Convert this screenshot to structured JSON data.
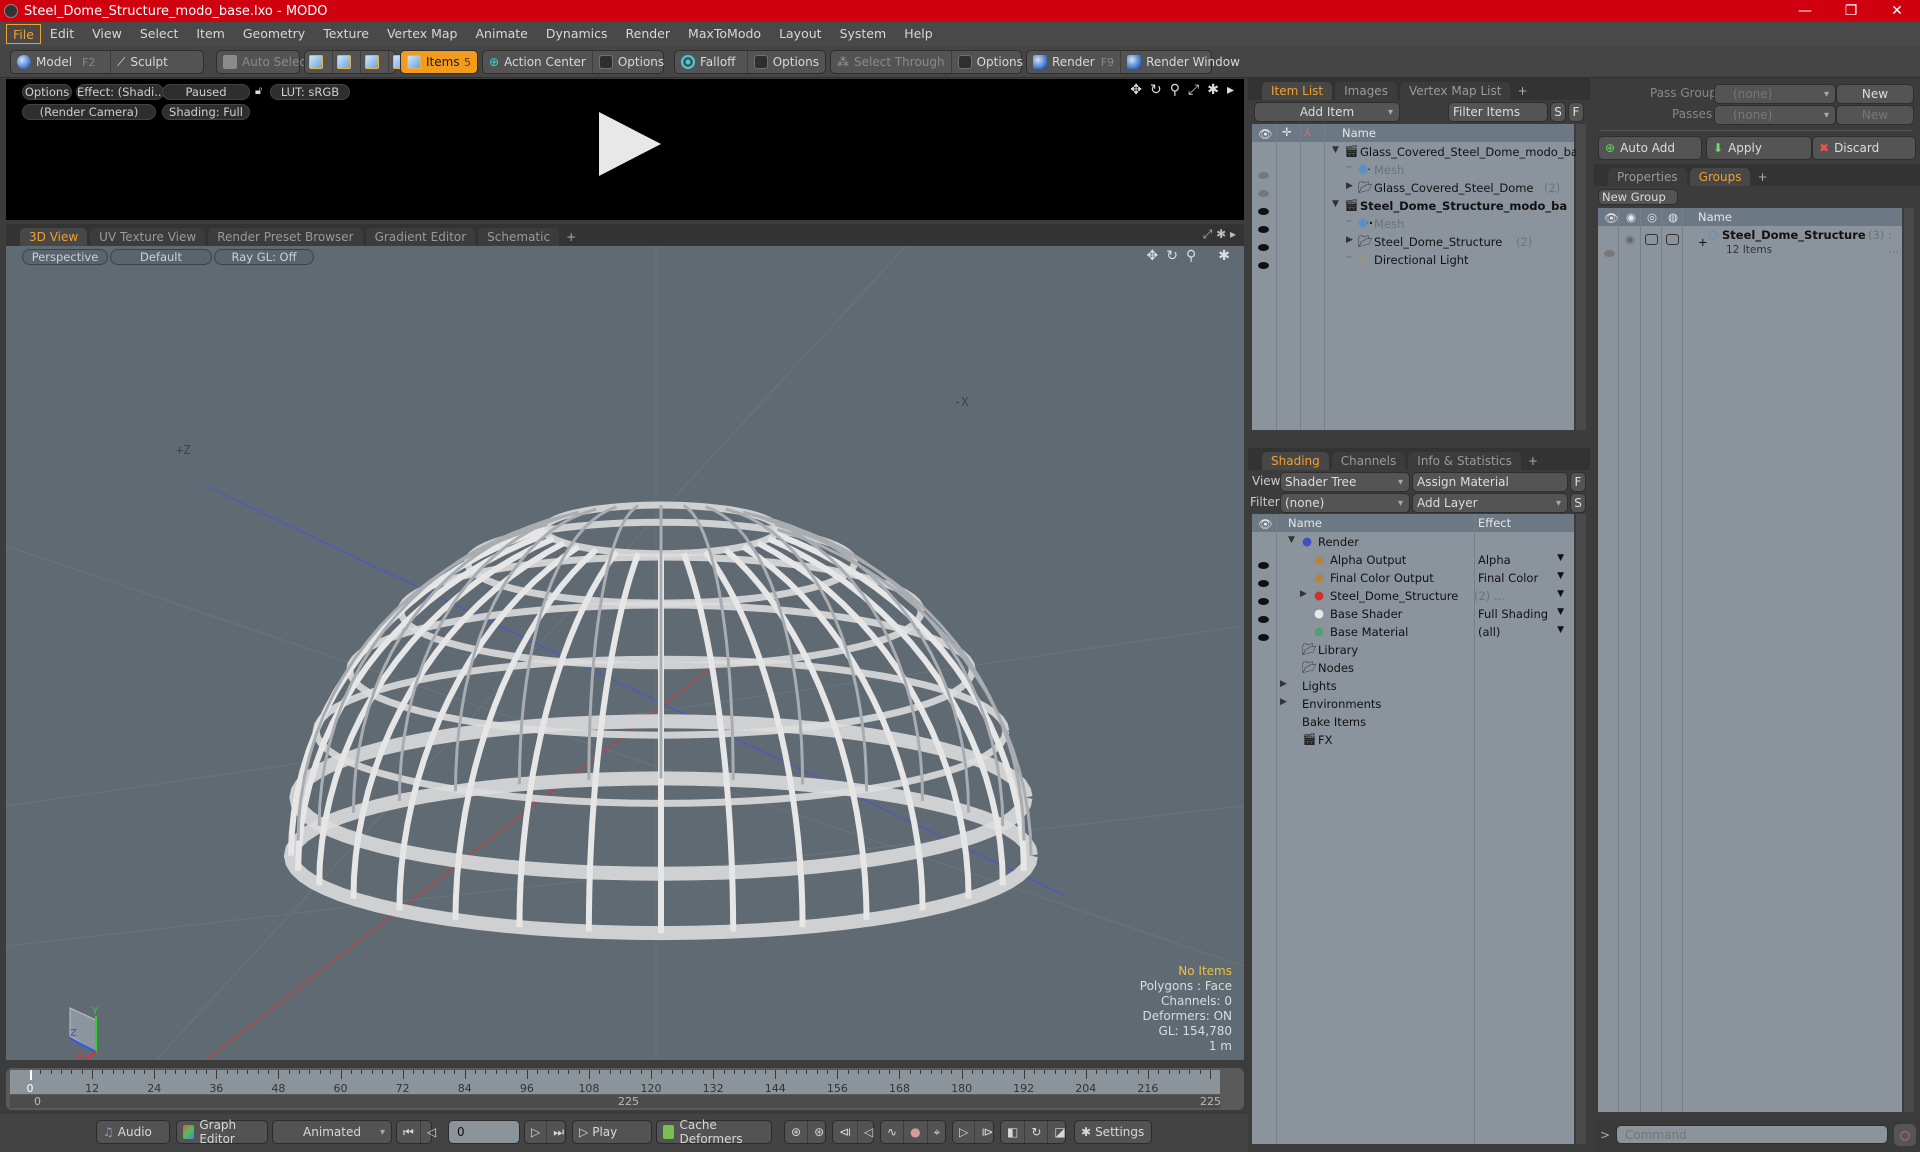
{
  "window": {
    "title": "Steel_Dome_Structure_modo_base.lxo - MODO",
    "controls": {
      "minimize": "—",
      "maximize": "❐",
      "close": "✕"
    }
  },
  "menu": [
    "File",
    "Edit",
    "View",
    "Select",
    "Item",
    "Geometry",
    "Texture",
    "Vertex Map",
    "Animate",
    "Dynamics",
    "Render",
    "MaxToModo",
    "Layout",
    "System",
    "Help"
  ],
  "toolbar": {
    "model": "Model",
    "model_key": "F2",
    "sculpt": "Sculpt",
    "auto_select": "Auto Select",
    "items": "Items",
    "items_key": "5",
    "action_center": "Action Center",
    "options1": "Options",
    "falloff": "Falloff",
    "options2": "Options",
    "select_through": "Select Through",
    "options3": "Options",
    "render": "Render",
    "render_key": "F9",
    "render_window": "Render Window"
  },
  "render_preview": {
    "options": "Options",
    "effect": "Effect: (Shadi...",
    "status": "Paused",
    "lut": "LUT: sRGB",
    "camera": "(Render Camera)",
    "shading": "Shading: Full"
  },
  "viewport_tabs": [
    "3D View",
    "UV Texture View",
    "Render Preset Browser",
    "Gradient Editor",
    "Schematic",
    "+"
  ],
  "viewport": {
    "projection": "Perspective",
    "style": "Default",
    "raygl": "Ray GL: Off",
    "axis_label_z": "+Z",
    "axis_label_x": "-X",
    "info": {
      "selection": "No Items",
      "polygons": "Polygons : Face",
      "channels": "Channels: 0",
      "deformers": "Deformers: ON",
      "gl": "GL: 154,780",
      "scale": "1 m"
    },
    "gizmo": {
      "y": "Y",
      "z": "Z",
      "x": "X"
    }
  },
  "timeline": {
    "labels": [
      "0",
      "12",
      "24",
      "36",
      "48",
      "60",
      "72",
      "84",
      "96",
      "108",
      "120",
      "132",
      "144",
      "156",
      "168",
      "180",
      "192",
      "204",
      "216"
    ],
    "range_start": "0",
    "range_mid": "225",
    "range_end": "225",
    "current_frame": "0"
  },
  "transport": {
    "audio": "Audio",
    "graph_editor": "Graph Editor",
    "mode": "Animated",
    "frame": "0",
    "play": "Play",
    "cache_deformers": "Cache Deformers",
    "settings": "Settings"
  },
  "item_list": {
    "tabs": [
      "Item List",
      "Images",
      "Vertex Map List",
      "+"
    ],
    "add_item": "Add Item",
    "filter": "Filter Items",
    "s": "S",
    "f": "F",
    "header_name": "Name",
    "rows": [
      {
        "label": "Glass_Covered_Steel_Dome_modo_bas ...",
        "indent": 0,
        "icon": "scene",
        "eye": "none",
        "bold": false,
        "expand": "▼"
      },
      {
        "label": "Mesh",
        "indent": 1,
        "icon": "mesh",
        "eye": "dim",
        "bold": false,
        "gray": true
      },
      {
        "label": "Glass_Covered_Steel_Dome",
        "count": "(2)",
        "indent": 1,
        "icon": "folder",
        "eye": "dim",
        "expand": "▶"
      },
      {
        "label": "Steel_Dome_Structure_modo_ba ...",
        "indent": 0,
        "icon": "scene",
        "eye": "on",
        "bold": true,
        "expand": "▼"
      },
      {
        "label": "Mesh",
        "indent": 1,
        "icon": "mesh",
        "eye": "on",
        "gray": true
      },
      {
        "label": "Steel_Dome_Structure",
        "count": "(2)",
        "indent": 1,
        "icon": "folder",
        "eye": "on",
        "expand": "▶"
      },
      {
        "label": "Directional Light",
        "indent": 1,
        "icon": "light",
        "eye": "on"
      }
    ]
  },
  "passes": {
    "pass_groups_label": "Pass Groups",
    "pass_groups_value": "(none)",
    "new1": "New",
    "passes_label": "Passes",
    "passes_value": "(none)",
    "new2": "New",
    "auto_add": "Auto Add",
    "apply": "Apply",
    "discard": "Discard"
  },
  "groups": {
    "tabs": [
      "Properties",
      "Groups",
      "+"
    ],
    "new_group": "New Group",
    "header_name": "Name",
    "row_name": "Steel_Dome_Structure",
    "row_count": "(3)",
    "row_suffix": ": ...",
    "row_sub": "12 Items"
  },
  "shading": {
    "tabs": [
      "Shading",
      "Channels",
      "Info & Statistics",
      "+"
    ],
    "view_label": "View",
    "view_value": "Shader Tree",
    "assign_material": "Assign Material",
    "f": "F",
    "filter_label": "Filter",
    "filter_value": "(none)",
    "add_layer": "Add Layer",
    "s": "S",
    "header_name": "Name",
    "header_effect": "Effect",
    "rows": [
      {
        "label": "Render",
        "effect": "",
        "indent": 1,
        "icon": "render-sphere",
        "eye": false,
        "expand": "▼"
      },
      {
        "label": "Alpha Output",
        "effect": "Alpha",
        "indent": 2,
        "icon": "output",
        "eye": true
      },
      {
        "label": "Final Color Output",
        "effect": "Final Color",
        "indent": 2,
        "icon": "output",
        "eye": true
      },
      {
        "label": "Steel_Dome_Structure",
        "count": "(2) ...",
        "effect": "",
        "indent": 2,
        "icon": "material-group",
        "eye": true,
        "expand": "▶"
      },
      {
        "label": "Base Shader",
        "effect": "Full Shading",
        "indent": 2,
        "icon": "shader",
        "eye": true
      },
      {
        "label": "Base Material",
        "effect": "(all)",
        "indent": 2,
        "icon": "material",
        "eye": true
      },
      {
        "label": "Library",
        "effect": "",
        "indent": 1,
        "icon": "folder",
        "eye": false
      },
      {
        "label": "Nodes",
        "effect": "",
        "indent": 1,
        "icon": "folder",
        "eye": false
      },
      {
        "label": "Lights",
        "effect": "",
        "indent": 0,
        "icon": "none",
        "eye": false,
        "expand": "▶"
      },
      {
        "label": "Environments",
        "effect": "",
        "indent": 0,
        "icon": "none",
        "eye": false,
        "expand": "▶"
      },
      {
        "label": "Bake Items",
        "effect": "",
        "indent": 0,
        "icon": "none",
        "eye": false
      },
      {
        "label": "FX",
        "effect": "",
        "indent": 1,
        "icon": "scene",
        "eye": false
      }
    ]
  },
  "command": {
    "prompt": ">",
    "placeholder": "Command"
  },
  "colors": {
    "accent": "#f0a030",
    "titlebar": "#d1000f",
    "viewport_bg": "#5f6a73",
    "list_bg": "#8b949d"
  }
}
